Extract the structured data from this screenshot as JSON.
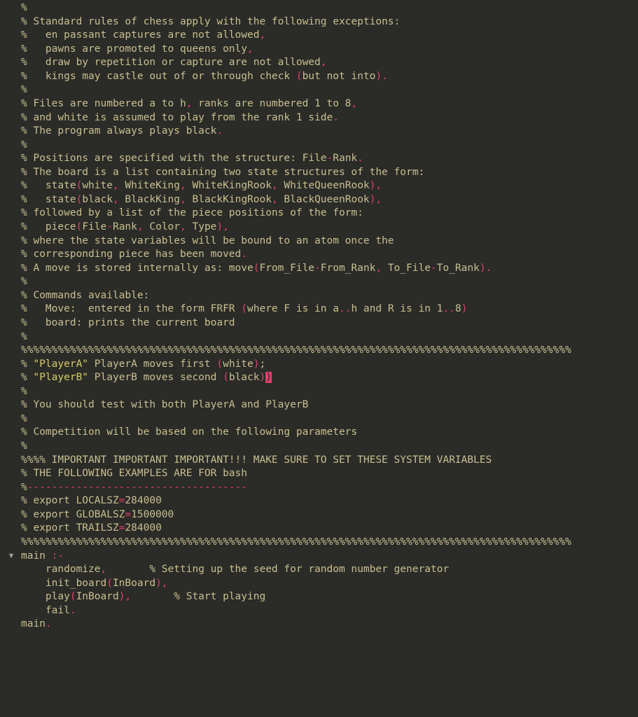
{
  "lines": [
    {
      "indent": 0,
      "segments": [
        {
          "t": "%",
          "c": "c-comment"
        }
      ]
    },
    {
      "indent": 0,
      "segments": [
        {
          "t": "% Standard rules of chess apply with the following exceptions:",
          "c": "c-comment"
        }
      ]
    },
    {
      "indent": 0,
      "segments": [
        {
          "t": "%   en passant captures are not allowed",
          "c": "c-comment"
        },
        {
          "t": ",",
          "c": "c-punct"
        }
      ]
    },
    {
      "indent": 0,
      "segments": [
        {
          "t": "%   pawns are promoted to queens only",
          "c": "c-comment"
        },
        {
          "t": ",",
          "c": "c-punct"
        }
      ]
    },
    {
      "indent": 0,
      "segments": [
        {
          "t": "%   draw by repetition or capture are not allowed",
          "c": "c-comment"
        },
        {
          "t": ",",
          "c": "c-punct"
        }
      ]
    },
    {
      "indent": 0,
      "segments": [
        {
          "t": "%   kings may castle out of or through check ",
          "c": "c-comment"
        },
        {
          "t": "(",
          "c": "c-punct"
        },
        {
          "t": "but not into",
          "c": "c-comment"
        },
        {
          "t": ")",
          "c": "c-punct"
        },
        {
          "t": ".",
          "c": "c-punct"
        }
      ]
    },
    {
      "indent": 0,
      "segments": [
        {
          "t": "%",
          "c": "c-comment"
        }
      ]
    },
    {
      "indent": 0,
      "segments": [
        {
          "t": "% Files are numbered a to h",
          "c": "c-comment"
        },
        {
          "t": ",",
          "c": "c-punct"
        },
        {
          "t": " ranks are numbered 1 to 8",
          "c": "c-comment"
        },
        {
          "t": ",",
          "c": "c-punct"
        }
      ]
    },
    {
      "indent": 0,
      "segments": [
        {
          "t": "% and white is assumed to play from the rank 1 side",
          "c": "c-comment"
        },
        {
          "t": ".",
          "c": "c-punct"
        }
      ]
    },
    {
      "indent": 0,
      "segments": [
        {
          "t": "% The program always plays black",
          "c": "c-comment"
        },
        {
          "t": ".",
          "c": "c-punct"
        }
      ]
    },
    {
      "indent": 0,
      "segments": [
        {
          "t": "%",
          "c": "c-comment"
        }
      ]
    },
    {
      "indent": 0,
      "segments": [
        {
          "t": "% Positions are specified with the structure: File",
          "c": "c-comment"
        },
        {
          "t": "-",
          "c": "c-punct"
        },
        {
          "t": "Rank",
          "c": "c-comment"
        },
        {
          "t": ".",
          "c": "c-punct"
        }
      ]
    },
    {
      "indent": 0,
      "segments": [
        {
          "t": "% The board is a list containing two state structures of the form:",
          "c": "c-comment"
        }
      ]
    },
    {
      "indent": 0,
      "segments": [
        {
          "t": "%   state",
          "c": "c-comment"
        },
        {
          "t": "(",
          "c": "c-punct"
        },
        {
          "t": "white",
          "c": "c-comment"
        },
        {
          "t": ",",
          "c": "c-punct"
        },
        {
          "t": " WhiteKing",
          "c": "c-comment"
        },
        {
          "t": ",",
          "c": "c-punct"
        },
        {
          "t": " WhiteKingRook",
          "c": "c-comment"
        },
        {
          "t": ",",
          "c": "c-punct"
        },
        {
          "t": " WhiteQueenRook",
          "c": "c-comment"
        },
        {
          "t": ")",
          "c": "c-punct"
        },
        {
          "t": ",",
          "c": "c-punct"
        }
      ]
    },
    {
      "indent": 0,
      "segments": [
        {
          "t": "%   state",
          "c": "c-comment"
        },
        {
          "t": "(",
          "c": "c-punct"
        },
        {
          "t": "black",
          "c": "c-comment"
        },
        {
          "t": ",",
          "c": "c-punct"
        },
        {
          "t": " BlackKing",
          "c": "c-comment"
        },
        {
          "t": ",",
          "c": "c-punct"
        },
        {
          "t": " BlackKingRook",
          "c": "c-comment"
        },
        {
          "t": ",",
          "c": "c-punct"
        },
        {
          "t": " BlackQueenRook",
          "c": "c-comment"
        },
        {
          "t": ")",
          "c": "c-punct"
        },
        {
          "t": ",",
          "c": "c-punct"
        }
      ]
    },
    {
      "indent": 0,
      "segments": [
        {
          "t": "% followed by a list of the piece positions of the form:",
          "c": "c-comment"
        }
      ]
    },
    {
      "indent": 0,
      "segments": [
        {
          "t": "%   piece",
          "c": "c-comment"
        },
        {
          "t": "(",
          "c": "c-punct"
        },
        {
          "t": "File",
          "c": "c-comment"
        },
        {
          "t": "-",
          "c": "c-punct"
        },
        {
          "t": "Rank",
          "c": "c-comment"
        },
        {
          "t": ",",
          "c": "c-punct"
        },
        {
          "t": " Color",
          "c": "c-comment"
        },
        {
          "t": ",",
          "c": "c-punct"
        },
        {
          "t": " Type",
          "c": "c-comment"
        },
        {
          "t": ")",
          "c": "c-punct"
        },
        {
          "t": ",",
          "c": "c-punct"
        }
      ]
    },
    {
      "indent": 0,
      "segments": [
        {
          "t": "% where the state variables will be bound to an atom once the",
          "c": "c-comment"
        }
      ]
    },
    {
      "indent": 0,
      "segments": [
        {
          "t": "% corresponding piece has been moved",
          "c": "c-comment"
        },
        {
          "t": ".",
          "c": "c-punct"
        }
      ]
    },
    {
      "indent": 0,
      "segments": [
        {
          "t": "% A move is stored internally as: move",
          "c": "c-comment"
        },
        {
          "t": "(",
          "c": "c-punct"
        },
        {
          "t": "From_File",
          "c": "c-comment"
        },
        {
          "t": "-",
          "c": "c-punct"
        },
        {
          "t": "From_Rank",
          "c": "c-comment"
        },
        {
          "t": ",",
          "c": "c-punct"
        },
        {
          "t": " To_File",
          "c": "c-comment"
        },
        {
          "t": "-",
          "c": "c-punct"
        },
        {
          "t": "To_Rank",
          "c": "c-comment"
        },
        {
          "t": ")",
          "c": "c-punct"
        },
        {
          "t": ".",
          "c": "c-punct"
        }
      ]
    },
    {
      "indent": 0,
      "segments": [
        {
          "t": "%",
          "c": "c-comment"
        }
      ]
    },
    {
      "indent": 0,
      "segments": [
        {
          "t": "% Commands available:",
          "c": "c-comment"
        }
      ]
    },
    {
      "indent": 0,
      "segments": [
        {
          "t": "%   Move:  entered in the form FRFR ",
          "c": "c-comment"
        },
        {
          "t": "(",
          "c": "c-punct"
        },
        {
          "t": "where F is in a",
          "c": "c-comment"
        },
        {
          "t": "..",
          "c": "c-punct"
        },
        {
          "t": "h and R is in 1",
          "c": "c-comment"
        },
        {
          "t": "..",
          "c": "c-punct"
        },
        {
          "t": "8",
          "c": "c-comment"
        },
        {
          "t": ")",
          "c": "c-punct"
        }
      ]
    },
    {
      "indent": 0,
      "segments": [
        {
          "t": "%   board: prints the current board",
          "c": "c-comment"
        }
      ]
    },
    {
      "indent": 0,
      "segments": [
        {
          "t": "%",
          "c": "c-comment"
        }
      ]
    },
    {
      "indent": 0,
      "segments": [
        {
          "t": "%%%%%%%%%%%%%%%%%%%%%%%%%%%%%%%%%%%%%%%%%%%%%%%%%%%%%%%%%%%%%%%%%%%%%%%%%%%%%%%%%%%%%%%%%%",
          "c": "c-comment"
        }
      ]
    },
    {
      "indent": 0,
      "segments": [
        {
          "t": "% ",
          "c": "c-comment"
        },
        {
          "t": "\"PlayerA\"",
          "c": "c-str"
        },
        {
          "t": " PlayerA moves first ",
          "c": "c-comment"
        },
        {
          "t": "(",
          "c": "c-punct"
        },
        {
          "t": "white",
          "c": "c-comment"
        },
        {
          "t": ")",
          "c": "c-punct"
        },
        {
          "t": ";",
          "c": "c-comment"
        }
      ]
    },
    {
      "indent": 0,
      "segments": [
        {
          "t": "% ",
          "c": "c-comment"
        },
        {
          "t": "\"PlayerB\"",
          "c": "c-str"
        },
        {
          "t": " PlayerB moves second ",
          "c": "c-comment"
        },
        {
          "t": "(",
          "c": "c-punct"
        },
        {
          "t": "black",
          "c": "c-comment"
        },
        {
          "t": ")",
          "c": "c-punct"
        },
        {
          "t": ")",
          "c": "cursor-hl"
        }
      ]
    },
    {
      "indent": 0,
      "segments": [
        {
          "t": "%",
          "c": "c-comment"
        }
      ]
    },
    {
      "indent": 0,
      "segments": [
        {
          "t": "% You should test with both PlayerA and PlayerB",
          "c": "c-comment"
        }
      ]
    },
    {
      "indent": 0,
      "segments": [
        {
          "t": "%",
          "c": "c-comment"
        }
      ]
    },
    {
      "indent": 0,
      "segments": [
        {
          "t": "% Competition will be based on the following parameters",
          "c": "c-comment"
        }
      ]
    },
    {
      "indent": 0,
      "segments": [
        {
          "t": "%",
          "c": "c-comment"
        }
      ]
    },
    {
      "indent": 0,
      "segments": [
        {
          "t": "%%%% IMPORTANT IMPORTANT IMPORTANT!!! MAKE SURE TO SET THESE SYSTEM VARIABLES",
          "c": "c-comment"
        }
      ]
    },
    {
      "indent": 0,
      "segments": [
        {
          "t": "% THE FOLLOWING EXAMPLES ARE FOR bash",
          "c": "c-comment"
        }
      ]
    },
    {
      "indent": 0,
      "segments": [
        {
          "t": "%",
          "c": "c-comment"
        },
        {
          "t": "------------------------------------",
          "c": "c-punct"
        }
      ]
    },
    {
      "indent": 0,
      "segments": [
        {
          "t": "% export LOCALSZ",
          "c": "c-comment"
        },
        {
          "t": "=",
          "c": "c-punct"
        },
        {
          "t": "284000",
          "c": "c-comment"
        }
      ]
    },
    {
      "indent": 0,
      "segments": [
        {
          "t": "% export GLOBALSZ",
          "c": "c-comment"
        },
        {
          "t": "=",
          "c": "c-punct"
        },
        {
          "t": "1500000",
          "c": "c-comment"
        }
      ]
    },
    {
      "indent": 0,
      "segments": [
        {
          "t": "% export TRAILSZ",
          "c": "c-comment"
        },
        {
          "t": "=",
          "c": "c-punct"
        },
        {
          "t": "284000",
          "c": "c-comment"
        }
      ]
    },
    {
      "indent": 0,
      "segments": [
        {
          "t": "%%%%%%%%%%%%%%%%%%%%%%%%%%%%%%%%%%%%%%%%%%%%%%%%%%%%%%%%%%%%%%%%%%%%%%%%%%%%%%%%%%%%%%%%%%",
          "c": "c-comment"
        }
      ]
    },
    {
      "indent": 0,
      "segments": [
        {
          "t": "",
          "c": "c-comment"
        }
      ]
    },
    {
      "indent": 0,
      "fold": true,
      "segments": [
        {
          "t": "main ",
          "c": "c-ident"
        },
        {
          "t": ":-",
          "c": "c-punct"
        }
      ]
    },
    {
      "indent": 0,
      "segments": [
        {
          "t": "    randomize",
          "c": "c-ident"
        },
        {
          "t": ",",
          "c": "c-punct"
        },
        {
          "t": "       % Setting up the seed for random number generator",
          "c": "c-comment"
        }
      ]
    },
    {
      "indent": 0,
      "segments": [
        {
          "t": "    init_board",
          "c": "c-ident"
        },
        {
          "t": "(",
          "c": "c-punct"
        },
        {
          "t": "InBoard",
          "c": "c-ident"
        },
        {
          "t": ")",
          "c": "c-punct"
        },
        {
          "t": ",",
          "c": "c-punct"
        }
      ]
    },
    {
      "indent": 0,
      "segments": [
        {
          "t": "    play",
          "c": "c-ident"
        },
        {
          "t": "(",
          "c": "c-punct"
        },
        {
          "t": "InBoard",
          "c": "c-ident"
        },
        {
          "t": ")",
          "c": "c-punct"
        },
        {
          "t": ",",
          "c": "c-punct"
        },
        {
          "t": "       % Start playing",
          "c": "c-comment"
        }
      ]
    },
    {
      "indent": 0,
      "segments": [
        {
          "t": "    fail",
          "c": "c-ident"
        },
        {
          "t": ".",
          "c": "c-punct"
        }
      ]
    },
    {
      "indent": 0,
      "segments": [
        {
          "t": "main",
          "c": "c-ident"
        },
        {
          "t": ".",
          "c": "c-punct"
        }
      ]
    }
  ],
  "fold_glyph": "▼"
}
